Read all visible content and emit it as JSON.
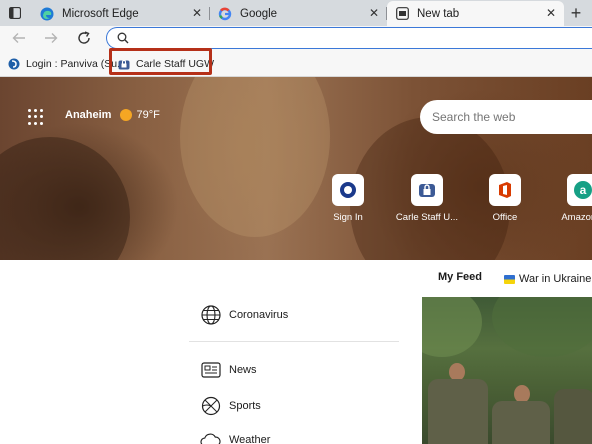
{
  "browser": {
    "tabs": [
      {
        "label": "Microsoft Edge",
        "active": false,
        "icon": "edge-icon"
      },
      {
        "label": "Google",
        "active": false,
        "icon": "google-icon"
      },
      {
        "label": "New tab",
        "active": true,
        "icon": "newtab-icon"
      }
    ],
    "address_bar": {
      "value": "",
      "placeholder": ""
    },
    "favorites": [
      {
        "label": "Login : Panviva (Su...",
        "icon": "panviva-icon"
      },
      {
        "label": "Carle Staff UGW",
        "icon": "lock-folder-icon",
        "highlighted": true
      }
    ]
  },
  "newtab": {
    "weather": {
      "city": "Anaheim",
      "temp": "79°F",
      "icon": "sun-icon"
    },
    "search": {
      "placeholder": "Search the web"
    },
    "quick_links": [
      {
        "label": "Sign In",
        "icon": "circle-o-icon"
      },
      {
        "label": "Carle Staff U...",
        "icon": "lock-folder-icon"
      },
      {
        "label": "Office",
        "icon": "office-icon"
      },
      {
        "label": "Amazon A",
        "icon": "amazon-icon"
      }
    ],
    "feed_tabs": [
      {
        "label": "My Feed",
        "active": true
      },
      {
        "label": "War in Ukraine",
        "icon": "ukraine-flag-icon"
      }
    ],
    "sidebar": [
      {
        "label": "Coronavirus",
        "icon": "globe-icon"
      },
      {
        "label": "News",
        "icon": "newspaper-icon"
      },
      {
        "label": "Sports",
        "icon": "basketball-icon"
      },
      {
        "label": "Weather",
        "icon": "cloud-icon"
      }
    ]
  },
  "colors": {
    "highlight_border": "#b53019",
    "address_focus": "#3b78d8",
    "tabstrip": "#d6dade"
  }
}
